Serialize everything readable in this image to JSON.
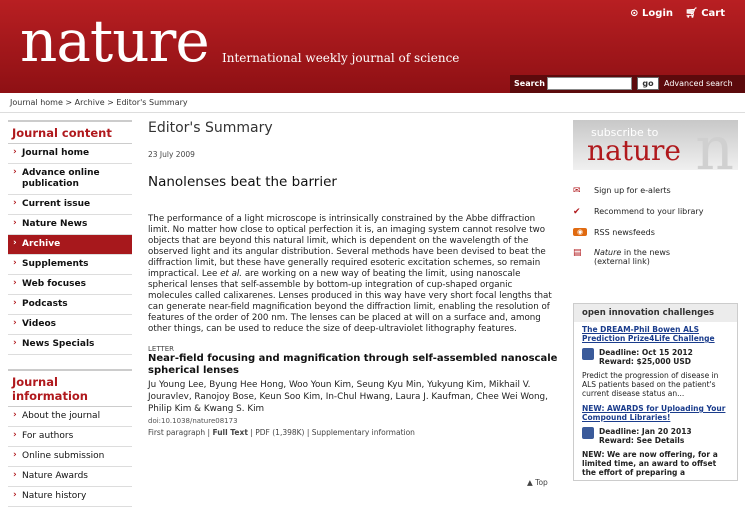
{
  "header": {
    "logo": "nature",
    "tagline": "International weekly journal of science",
    "login": "Login",
    "cart": "Cart",
    "search_label": "Search",
    "go": "go",
    "advanced": "Advanced search"
  },
  "breadcrumb": "Journal home > Archive > Editor's Summary",
  "nav_content": {
    "heading": "Journal content",
    "items": [
      "Journal home",
      "Advance online publication",
      "Current issue",
      "Nature News",
      "Archive",
      "Supplements",
      "Web focuses",
      "Podcasts",
      "Videos",
      "News Specials"
    ]
  },
  "nav_info": {
    "heading": "Journal information",
    "items": [
      "About the journal",
      "For authors",
      "Online submission",
      "Nature Awards",
      "Nature history"
    ]
  },
  "main": {
    "heading": "Editor's Summary",
    "date": "23 July 2009",
    "title": "Nanolenses beat the barrier",
    "abstract_1": "The performance of a light microscope is intrinsically constrained by the Abbe diffraction limit. No matter how close to optical perfection it is, an imaging system cannot resolve two objects that are beyond this natural limit, which is dependent on the wavelength of the observed light and its angular distribution. Several methods have been devised to beat the diffraction limit, but these have generally required esoteric excitation schemes, so remain impractical. Lee ",
    "abstract_em": "et al.",
    "abstract_2": " are working on a new way of beating the limit, using nanoscale spherical lenses that self-assemble by bottom-up integration of cup-shaped organic molecules called calixarenes. Lenses produced in this way have very short focal lengths that can generate near-field magnification beyond the diffraction limit, enabling the resolution of features of the order of 200 nm. The lenses can be placed at will on a surface and, among other things, can be used to reduce the size of deep-ultraviolet lithography features.",
    "type": "LETTER",
    "article_title": "Near-field focusing and magnification through self-assembled nanoscale spherical lenses",
    "authors": "Ju Young Lee, Byung Hee Hong, Woo Youn Kim, Seung Kyu Min, Yukyung Kim, Mikhail V. Jouravlev, Ranojoy Bose, Keun Soo Kim, In-Chul Hwang, Laura J. Kaufman, Chee Wei Wong, Philip Kim & Kwang S. Kim",
    "doi": "doi:10.1038/nature08173",
    "link_first": "First paragraph",
    "link_full": "Full Text",
    "link_pdf": "PDF (1,398K)",
    "link_supp": "Supplementary information",
    "top": "Top"
  },
  "subscribe": {
    "line1": "subscribe to",
    "line2": "nature",
    "bg": "n"
  },
  "tools": {
    "alerts": "Sign up for e-alerts",
    "recommend": "Recommend to your library",
    "rss": "RSS newsfeeds",
    "news_1": "Nature",
    "news_2": " in the news",
    "news_3": "(external link)"
  },
  "oic": {
    "heading": "open innovation challenges",
    "c1_title": "The DREAM-Phil Bowen ALS Prediction Prize4Life Challenge",
    "c1_deadline": "Deadline: Oct 15 2012",
    "c1_reward": "Reward: $25,000 USD",
    "c1_desc": "Predict the progression of disease in ALS patients based on the patient's current disease status an...",
    "c2_title": "NEW: AWARDS for Uploading Your Compound Libraries!",
    "c2_deadline": "Deadline: Jan 20 2013",
    "c2_reward": "Reward: See Details",
    "c3_desc": "NEW: We are now offering, for a limited time, an award to offset the effort of preparing a"
  },
  "colors": {
    "brand": "#a7181c",
    "link": "#1a3c8c"
  }
}
